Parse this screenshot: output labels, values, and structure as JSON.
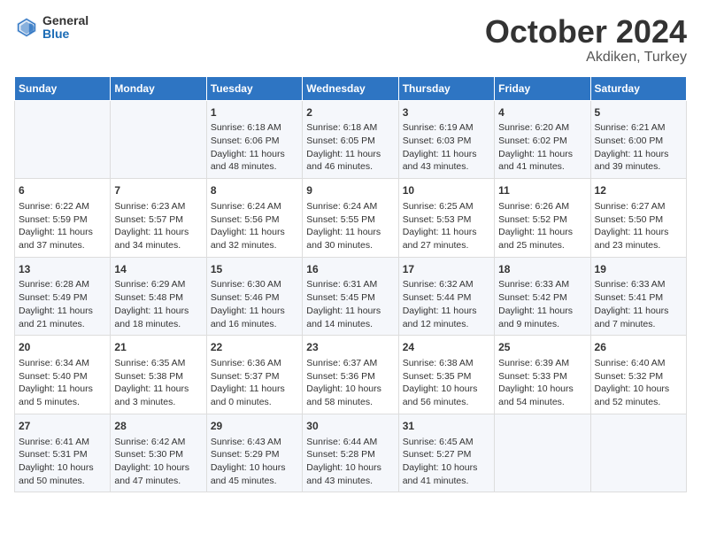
{
  "header": {
    "logo_line1": "General",
    "logo_line2": "Blue",
    "title": "October 2024",
    "subtitle": "Akdiken, Turkey"
  },
  "weekdays": [
    "Sunday",
    "Monday",
    "Tuesday",
    "Wednesday",
    "Thursday",
    "Friday",
    "Saturday"
  ],
  "weeks": [
    [
      {
        "day": "",
        "content": ""
      },
      {
        "day": "",
        "content": ""
      },
      {
        "day": "1",
        "content": "Sunrise: 6:18 AM\nSunset: 6:06 PM\nDaylight: 11 hours and 48 minutes."
      },
      {
        "day": "2",
        "content": "Sunrise: 6:18 AM\nSunset: 6:05 PM\nDaylight: 11 hours and 46 minutes."
      },
      {
        "day": "3",
        "content": "Sunrise: 6:19 AM\nSunset: 6:03 PM\nDaylight: 11 hours and 43 minutes."
      },
      {
        "day": "4",
        "content": "Sunrise: 6:20 AM\nSunset: 6:02 PM\nDaylight: 11 hours and 41 minutes."
      },
      {
        "day": "5",
        "content": "Sunrise: 6:21 AM\nSunset: 6:00 PM\nDaylight: 11 hours and 39 minutes."
      }
    ],
    [
      {
        "day": "6",
        "content": "Sunrise: 6:22 AM\nSunset: 5:59 PM\nDaylight: 11 hours and 37 minutes."
      },
      {
        "day": "7",
        "content": "Sunrise: 6:23 AM\nSunset: 5:57 PM\nDaylight: 11 hours and 34 minutes."
      },
      {
        "day": "8",
        "content": "Sunrise: 6:24 AM\nSunset: 5:56 PM\nDaylight: 11 hours and 32 minutes."
      },
      {
        "day": "9",
        "content": "Sunrise: 6:24 AM\nSunset: 5:55 PM\nDaylight: 11 hours and 30 minutes."
      },
      {
        "day": "10",
        "content": "Sunrise: 6:25 AM\nSunset: 5:53 PM\nDaylight: 11 hours and 27 minutes."
      },
      {
        "day": "11",
        "content": "Sunrise: 6:26 AM\nSunset: 5:52 PM\nDaylight: 11 hours and 25 minutes."
      },
      {
        "day": "12",
        "content": "Sunrise: 6:27 AM\nSunset: 5:50 PM\nDaylight: 11 hours and 23 minutes."
      }
    ],
    [
      {
        "day": "13",
        "content": "Sunrise: 6:28 AM\nSunset: 5:49 PM\nDaylight: 11 hours and 21 minutes."
      },
      {
        "day": "14",
        "content": "Sunrise: 6:29 AM\nSunset: 5:48 PM\nDaylight: 11 hours and 18 minutes."
      },
      {
        "day": "15",
        "content": "Sunrise: 6:30 AM\nSunset: 5:46 PM\nDaylight: 11 hours and 16 minutes."
      },
      {
        "day": "16",
        "content": "Sunrise: 6:31 AM\nSunset: 5:45 PM\nDaylight: 11 hours and 14 minutes."
      },
      {
        "day": "17",
        "content": "Sunrise: 6:32 AM\nSunset: 5:44 PM\nDaylight: 11 hours and 12 minutes."
      },
      {
        "day": "18",
        "content": "Sunrise: 6:33 AM\nSunset: 5:42 PM\nDaylight: 11 hours and 9 minutes."
      },
      {
        "day": "19",
        "content": "Sunrise: 6:33 AM\nSunset: 5:41 PM\nDaylight: 11 hours and 7 minutes."
      }
    ],
    [
      {
        "day": "20",
        "content": "Sunrise: 6:34 AM\nSunset: 5:40 PM\nDaylight: 11 hours and 5 minutes."
      },
      {
        "day": "21",
        "content": "Sunrise: 6:35 AM\nSunset: 5:38 PM\nDaylight: 11 hours and 3 minutes."
      },
      {
        "day": "22",
        "content": "Sunrise: 6:36 AM\nSunset: 5:37 PM\nDaylight: 11 hours and 0 minutes."
      },
      {
        "day": "23",
        "content": "Sunrise: 6:37 AM\nSunset: 5:36 PM\nDaylight: 10 hours and 58 minutes."
      },
      {
        "day": "24",
        "content": "Sunrise: 6:38 AM\nSunset: 5:35 PM\nDaylight: 10 hours and 56 minutes."
      },
      {
        "day": "25",
        "content": "Sunrise: 6:39 AM\nSunset: 5:33 PM\nDaylight: 10 hours and 54 minutes."
      },
      {
        "day": "26",
        "content": "Sunrise: 6:40 AM\nSunset: 5:32 PM\nDaylight: 10 hours and 52 minutes."
      }
    ],
    [
      {
        "day": "27",
        "content": "Sunrise: 6:41 AM\nSunset: 5:31 PM\nDaylight: 10 hours and 50 minutes."
      },
      {
        "day": "28",
        "content": "Sunrise: 6:42 AM\nSunset: 5:30 PM\nDaylight: 10 hours and 47 minutes."
      },
      {
        "day": "29",
        "content": "Sunrise: 6:43 AM\nSunset: 5:29 PM\nDaylight: 10 hours and 45 minutes."
      },
      {
        "day": "30",
        "content": "Sunrise: 6:44 AM\nSunset: 5:28 PM\nDaylight: 10 hours and 43 minutes."
      },
      {
        "day": "31",
        "content": "Sunrise: 6:45 AM\nSunset: 5:27 PM\nDaylight: 10 hours and 41 minutes."
      },
      {
        "day": "",
        "content": ""
      },
      {
        "day": "",
        "content": ""
      }
    ]
  ]
}
